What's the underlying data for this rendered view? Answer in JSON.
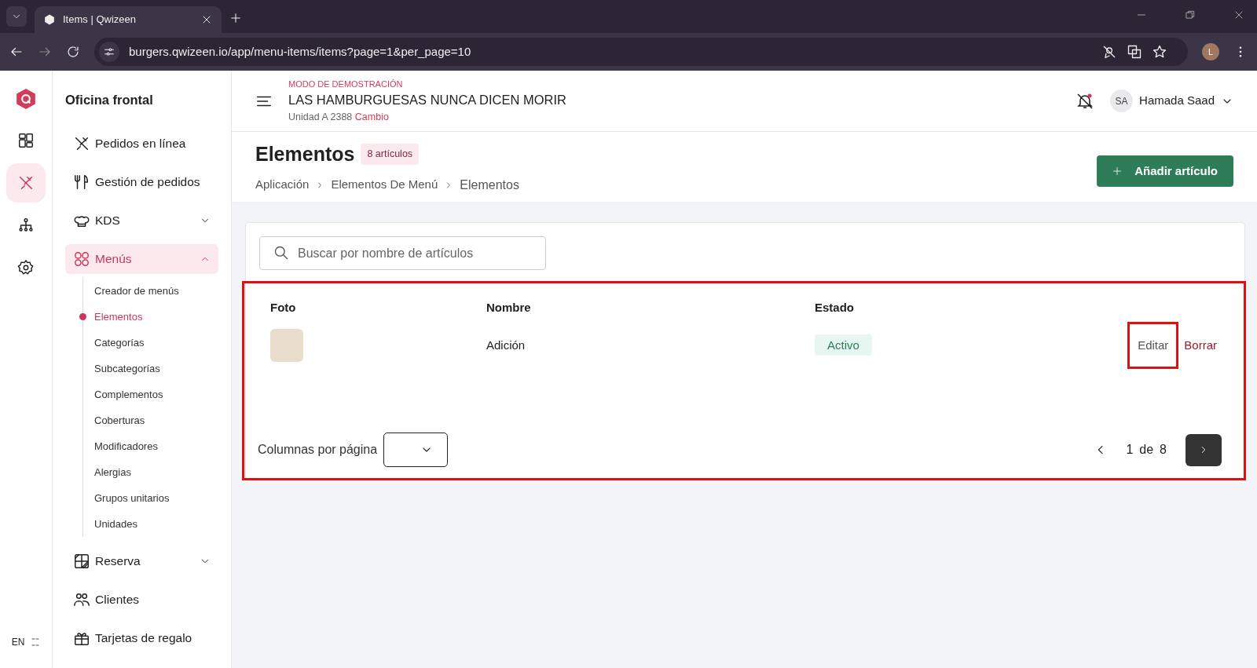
{
  "browser": {
    "tab_title": "Items | Qwizeen",
    "url": "burgers.qwizeen.io/app/menu-items/items?page=1&per_page=10",
    "profile_initial": "L"
  },
  "rail": {
    "items": [
      {
        "kind": "dashboard",
        "selected": false
      },
      {
        "kind": "menu",
        "selected": true
      },
      {
        "kind": "org",
        "selected": false
      },
      {
        "kind": "settings",
        "selected": false
      }
    ],
    "language": "EN"
  },
  "sidebar": {
    "title": "Oficina frontal",
    "items": [
      {
        "kind": "orders",
        "label": "Pedidos en línea",
        "selected": false
      },
      {
        "kind": "manage",
        "label": "Gestión de pedidos",
        "selected": false
      },
      {
        "kind": "kds",
        "label": "KDS",
        "selected": false,
        "expanded": false
      },
      {
        "kind": "menus",
        "label": "Menús",
        "selected": true,
        "expanded": true,
        "children": [
          {
            "label": "Creador de menús",
            "selected": false
          },
          {
            "label": "Elementos",
            "selected": true
          },
          {
            "label": "Categorías",
            "selected": false
          },
          {
            "label": "Subcategorías",
            "selected": false
          },
          {
            "label": "Complementos",
            "selected": false
          },
          {
            "label": "Coberturas",
            "selected": false
          },
          {
            "label": "Modificadores",
            "selected": false
          },
          {
            "label": "Alergias",
            "selected": false
          },
          {
            "label": "Grupos unitarios",
            "selected": false
          },
          {
            "label": "Unidades",
            "selected": false
          }
        ]
      },
      {
        "kind": "booking",
        "label": "Reserva",
        "selected": false,
        "expanded": false
      },
      {
        "kind": "clients",
        "label": "Clientes",
        "selected": false
      },
      {
        "kind": "gift",
        "label": "Tarjetas de regalo",
        "selected": false
      }
    ]
  },
  "header": {
    "demo_label": "MODO DE DEMOSTRACIÓN",
    "restaurant": "LAS HAMBURGUESAS NUNCA DICEN MORIR",
    "unit": "Unidad A 2388",
    "change_link": "Cambio",
    "user_initials": "SA",
    "user_name": "Hamada Saad"
  },
  "page": {
    "title": "Elementos",
    "count_badge": "8 artículos",
    "breadcrumbs": [
      "Aplicación",
      "Elementos De Menú",
      "Elementos"
    ],
    "add_button": "Añadir artículo"
  },
  "search": {
    "placeholder": "Buscar por nombre de artículos"
  },
  "table": {
    "highlighted": true,
    "columns": [
      "Foto",
      "Nombre",
      "Estado"
    ],
    "rows": [
      {
        "name": "Adición",
        "status": "Activo",
        "active": true,
        "actions": [
          {
            "kind": "edit",
            "label": "Editar",
            "highlighted": true
          },
          {
            "kind": "delete",
            "label": "Borrar",
            "highlighted": false
          }
        ]
      }
    ],
    "per_page_label": "Columnas por página",
    "page_current": "1",
    "page_of": "de",
    "page_total": "8"
  }
}
